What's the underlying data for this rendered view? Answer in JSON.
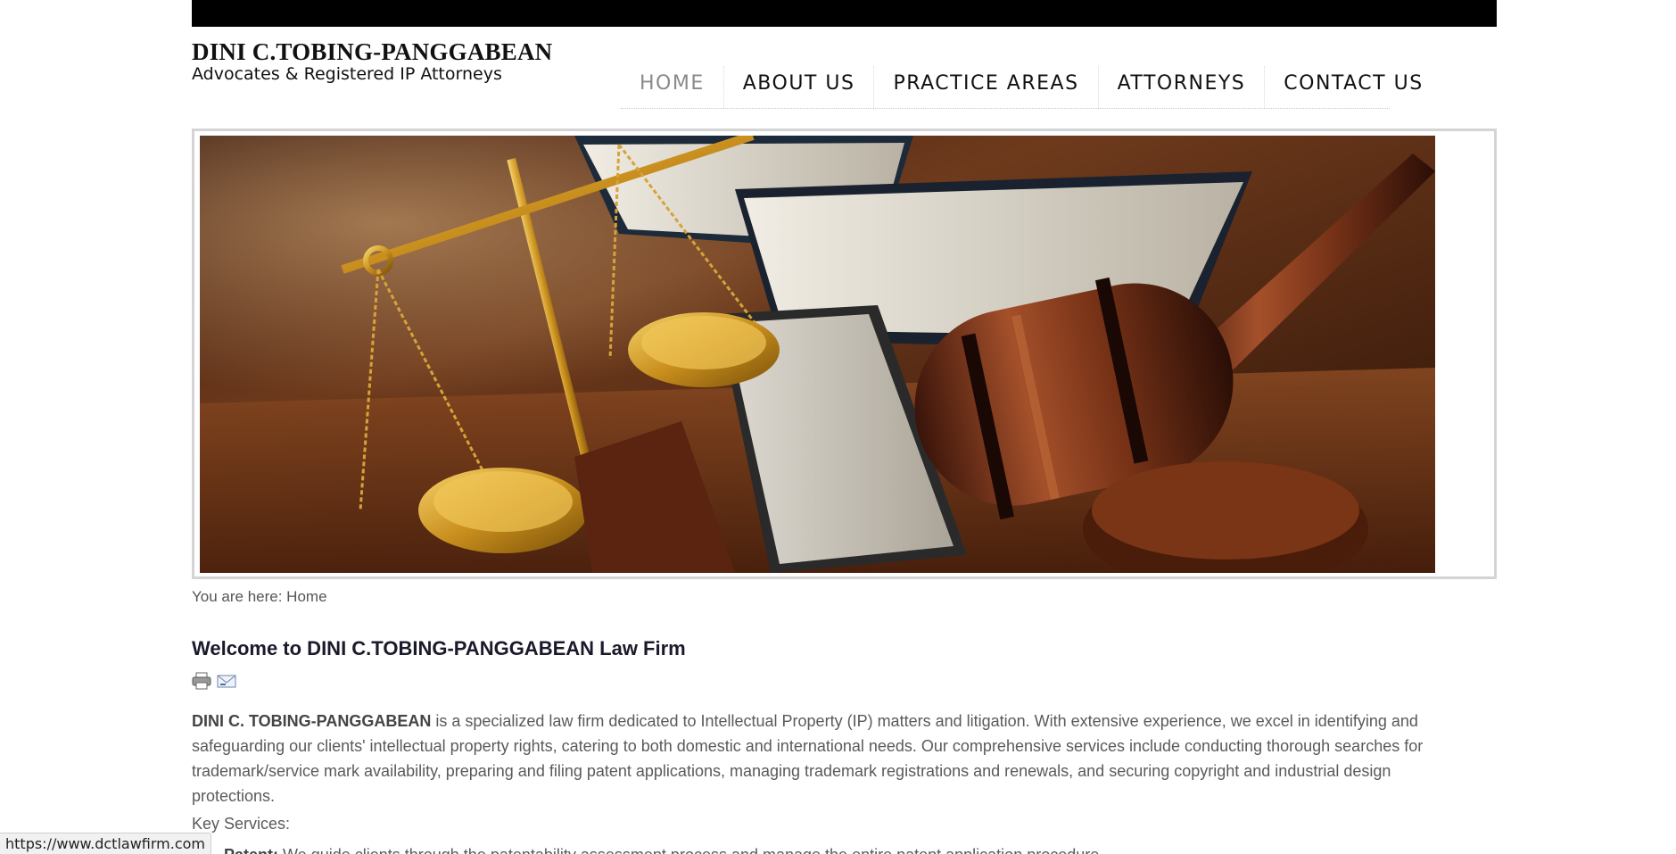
{
  "header": {
    "firm_name": "DINI C.TOBING-PANGGABEAN",
    "tagline": "Advocates & Registered IP Attorneys"
  },
  "nav": {
    "items": [
      {
        "label": "HOME",
        "active": true
      },
      {
        "label": "ABOUT US",
        "active": false
      },
      {
        "label": "PRACTICE AREAS",
        "active": false
      },
      {
        "label": "ATTORNEYS",
        "active": false
      },
      {
        "label": "CONTACT US",
        "active": false
      }
    ]
  },
  "hero": {
    "alt": "Scales of justice, law books and a wooden gavel"
  },
  "breadcrumb": {
    "text": "You are here: Home"
  },
  "article": {
    "title": "Welcome to DINI C.TOBING-PANGGABEAN Law Firm",
    "tools": {
      "print_icon": "printer-icon",
      "email_icon": "email-icon"
    },
    "lead_strong": "DINI C. TOBING-PANGGABEAN",
    "lead_text": " is a specialized law firm dedicated to Intellectual Property (IP) matters and litigation. With extensive experience, we excel in identifying and safeguarding our clients' intellectual property rights, catering to both domestic and international needs. Our comprehensive services include conducting thorough searches for trademark/service mark availability, preparing and filing patent applications, managing trademark registrations and renewals, and securing copyright and industrial design protections.",
    "key_services_label": "Key Services:",
    "service_1_label": "Patent:",
    "service_1_text": " We guide clients through the patentability assessment process and manage the entire patent application procedure."
  },
  "status_bar": {
    "url": "https://www.dctlawfirm.com"
  },
  "colors": {
    "top_bar": "#000000",
    "nav_active": "#8a8a8a",
    "body_text": "#5a5a5a",
    "frame_border": "#d4d4d4"
  }
}
